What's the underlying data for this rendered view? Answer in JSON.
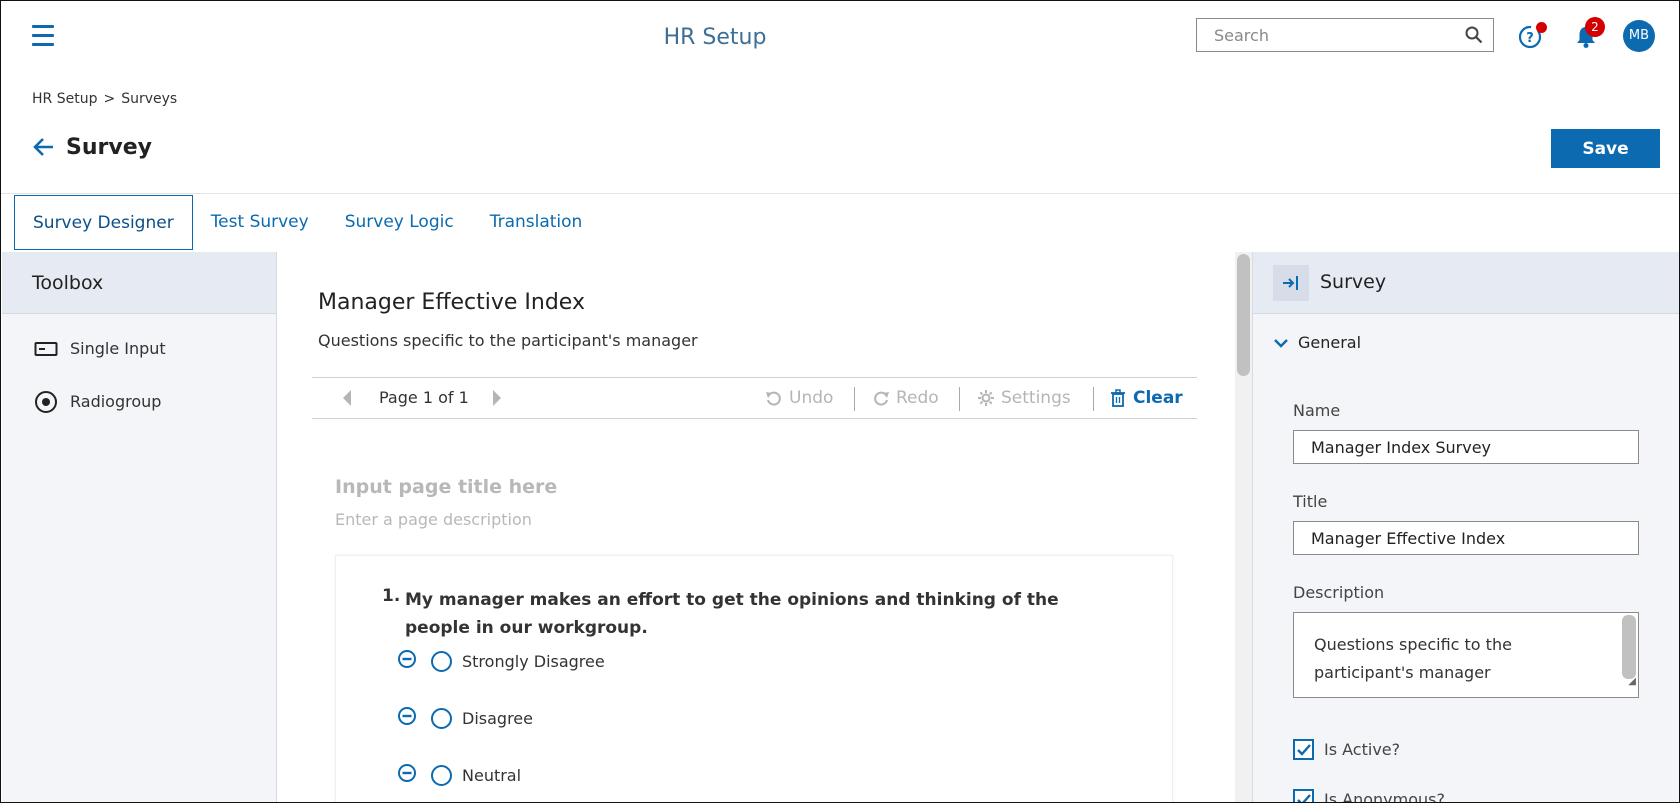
{
  "app": {
    "title": "HR Setup",
    "search_placeholder": "Search",
    "notifications_count": "2",
    "avatar_initials": "MB",
    "accent": "#0b6ab0",
    "badge_color": "#d40000"
  },
  "breadcrumb": {
    "root": "HR Setup",
    "separator": ">",
    "current": "Surveys"
  },
  "page": {
    "title": "Survey",
    "save_label": "Save"
  },
  "tabs": [
    {
      "label": "Survey Designer",
      "active": true
    },
    {
      "label": "Test Survey",
      "active": false
    },
    {
      "label": "Survey Logic",
      "active": false
    },
    {
      "label": "Translation",
      "active": false
    }
  ],
  "toolbox": {
    "title": "Toolbox",
    "items": [
      {
        "label": "Single Input",
        "icon": "single-input-icon"
      },
      {
        "label": "Radiogroup",
        "icon": "radiogroup-icon"
      }
    ]
  },
  "designer": {
    "survey_title": "Manager Effective Index",
    "survey_description": "Questions specific to the participant's manager",
    "pager": "Page 1 of 1",
    "actions": {
      "undo": "Undo",
      "redo": "Redo",
      "settings": "Settings",
      "clear": "Clear"
    },
    "page_title_placeholder": "Input page title here",
    "page_description_placeholder": "Enter a page description",
    "question": {
      "number": "1.",
      "text": "My manager makes an effort to get the opinions and thinking of the people in our workgroup.",
      "choices": [
        "Strongly Disagree",
        "Disagree",
        "Neutral"
      ]
    }
  },
  "properties": {
    "title": "Survey",
    "section": "General",
    "name_label": "Name",
    "name_value": "Manager Index Survey",
    "title_label": "Title",
    "title_value": "Manager Effective Index",
    "description_label": "Description",
    "description_value": "Questions specific to the participant's manager",
    "is_active_label": "Is Active?",
    "is_active": true,
    "is_anonymous_label": "Is Anonymous?",
    "is_anonymous": true
  }
}
